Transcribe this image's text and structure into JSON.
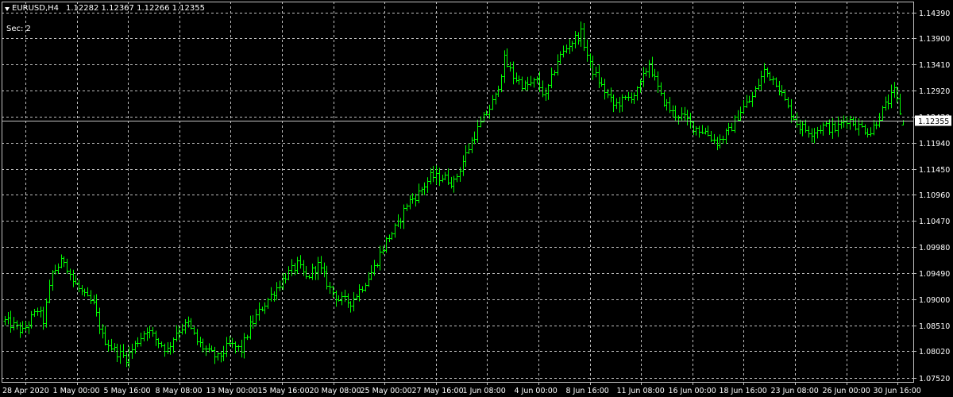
{
  "header": {
    "symbol_label": "EURUSD,H4",
    "ohlc": "1.12282 1.12367 1.12266 1.12355",
    "indicator_label": "Sec: 2"
  },
  "chart_data": {
    "type": "ohlc_bar",
    "symbol": "EURUSD",
    "timeframe": "H4",
    "last": {
      "open": 1.12282,
      "high": 1.12367,
      "low": 1.12266,
      "close": 1.12355
    },
    "current_price_label": "1.12355",
    "current_price": 1.12355,
    "ylim": [
      1.0752,
      1.1439
    ],
    "y_ticks": [
      "1.14390",
      "1.13900",
      "1.13410",
      "1.12920",
      "1.12430",
      "1.11940",
      "1.11450",
      "1.10960",
      "1.10470",
      "1.09980",
      "1.09490",
      "1.09000",
      "1.08510",
      "1.08020",
      "1.07520"
    ],
    "x_labels": [
      "28 Apr 2020",
      "1 May 00:00",
      "5 May 16:00",
      "8 May 08:00",
      "13 May 00:00",
      "15 May 16:00",
      "20 May 08:00",
      "25 May 00:00",
      "27 May 16:00",
      "1 Jun 08:00",
      "4 Jun 00:00",
      "8 Jun 16:00",
      "11 Jun 08:00",
      "16 Jun 00:00",
      "18 Jun 16:00",
      "23 Jun 08:00",
      "26 Jun 00:00",
      "30 Jun 16:00"
    ],
    "grid": true,
    "colors": {
      "bars": "#00ff00",
      "background": "#000000",
      "grid": "#c0c0c0",
      "text": "#ffffff"
    },
    "close_path": [
      [
        0,
        1.086
      ],
      [
        6,
        1.084
      ],
      [
        11,
        1.088
      ],
      [
        13,
        1.086
      ],
      [
        16,
        1.095
      ],
      [
        20,
        1.0975
      ],
      [
        23,
        1.0935
      ],
      [
        27,
        1.0905
      ],
      [
        30,
        1.089
      ],
      [
        33,
        1.083
      ],
      [
        37,
        1.0805
      ],
      [
        41,
        1.079
      ],
      [
        44,
        1.0815
      ],
      [
        48,
        1.0845
      ],
      [
        51,
        1.0825
      ],
      [
        55,
        1.0805
      ],
      [
        58,
        1.084
      ],
      [
        62,
        1.0855
      ],
      [
        65,
        1.082
      ],
      [
        69,
        1.08
      ],
      [
        72,
        1.079
      ],
      [
        76,
        1.0815
      ],
      [
        80,
        1.0805
      ],
      [
        83,
        1.085
      ],
      [
        87,
        1.0885
      ],
      [
        91,
        1.0915
      ],
      [
        95,
        1.0945
      ],
      [
        99,
        1.0965
      ],
      [
        102,
        1.094
      ],
      [
        106,
        1.0965
      ],
      [
        110,
        1.092
      ],
      [
        113,
        1.09
      ],
      [
        117,
        1.0895
      ],
      [
        121,
        1.0925
      ],
      [
        125,
        1.096
      ],
      [
        129,
        1.101
      ],
      [
        133,
        1.104
      ],
      [
        136,
        1.108
      ],
      [
        140,
        1.11
      ],
      [
        144,
        1.113
      ],
      [
        148,
        1.113
      ],
      [
        152,
        1.112
      ],
      [
        155,
        1.116
      ],
      [
        159,
        1.121
      ],
      [
        163,
        1.125
      ],
      [
        166,
        1.128
      ],
      [
        169,
        1.135
      ],
      [
        172,
        1.132
      ],
      [
        176,
        1.13
      ],
      [
        180,
        1.131
      ],
      [
        183,
        1.128
      ],
      [
        187,
        1.135
      ],
      [
        191,
        1.138
      ],
      [
        195,
        1.14
      ],
      [
        198,
        1.134
      ],
      [
        202,
        1.13
      ],
      [
        206,
        1.1265
      ],
      [
        210,
        1.1275
      ],
      [
        214,
        1.129
      ],
      [
        218,
        1.1345
      ],
      [
        222,
        1.128
      ],
      [
        226,
        1.125
      ],
      [
        229,
        1.1245
      ],
      [
        233,
        1.1225
      ],
      [
        237,
        1.1215
      ],
      [
        241,
        1.1195
      ],
      [
        245,
        1.1215
      ],
      [
        249,
        1.1255
      ],
      [
        253,
        1.128
      ],
      [
        257,
        1.133
      ],
      [
        261,
        1.131
      ],
      [
        265,
        1.126
      ],
      [
        269,
        1.1225
      ],
      [
        273,
        1.1215
      ],
      [
        277,
        1.1225
      ],
      [
        281,
        1.122
      ],
      [
        285,
        1.124
      ],
      [
        289,
        1.1225
      ],
      [
        293,
        1.1215
      ],
      [
        297,
        1.1255
      ],
      [
        301,
        1.129
      ],
      [
        304,
        1.1235
      ]
    ]
  }
}
